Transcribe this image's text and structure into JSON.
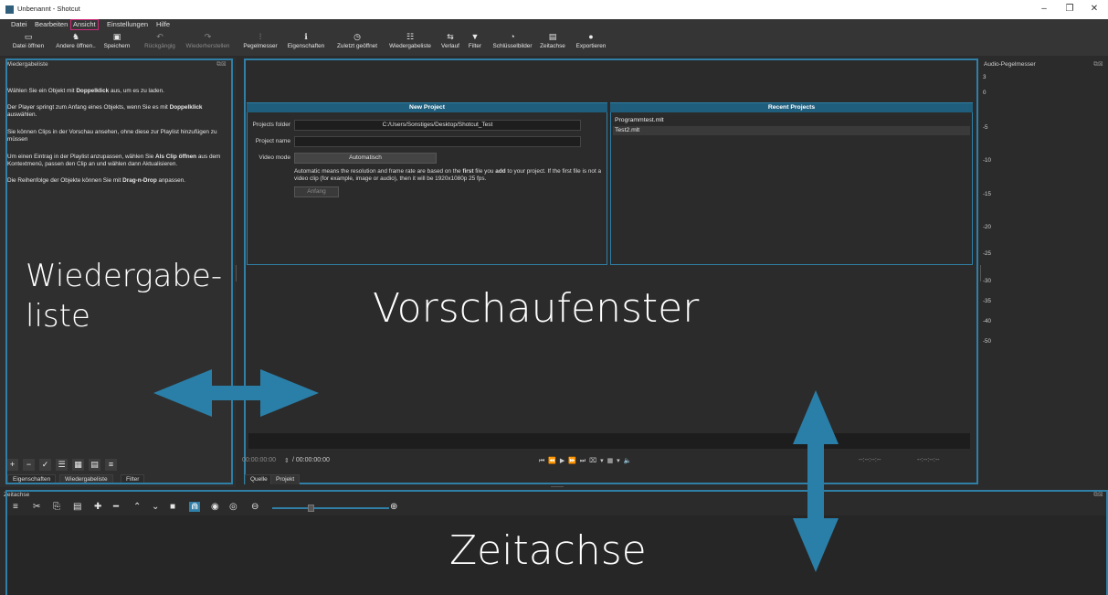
{
  "window": {
    "title": "Unbenannt - Shotcut",
    "controls": [
      "–",
      "❐",
      "✕"
    ]
  },
  "menu": [
    "Datei",
    "Bearbeiten",
    "Ansicht",
    "Einstellungen",
    "Hilfe"
  ],
  "menu_active": "Ansicht",
  "toolbar": [
    {
      "icon": "▭",
      "label": "Datei öffnen"
    },
    {
      "icon": "♞",
      "label": "Andere öffnen.."
    },
    {
      "icon": "▣",
      "label": "Speichern"
    },
    {
      "icon": "↶",
      "label": "Rückgängig"
    },
    {
      "icon": "↷",
      "label": "Wiederherstellen"
    },
    {
      "icon": "⫶",
      "label": "Pegelmesser"
    },
    {
      "icon": "ℹ",
      "label": "Eigenschaften"
    },
    {
      "icon": "◷",
      "label": "Zuletzt geöffnet"
    },
    {
      "icon": "☷",
      "label": "Wiedergabeliste"
    },
    {
      "icon": "⇆",
      "label": "Verlauf"
    },
    {
      "icon": "▼",
      "label": "Filter"
    },
    {
      "icon": "◔",
      "label": "Schlüsselbilder"
    },
    {
      "icon": "▤",
      "label": "Zeitachse"
    },
    {
      "icon": "●",
      "label": "Exportieren"
    }
  ],
  "playlist": {
    "title": "Wiedergabeliste",
    "paragraphs": [
      [
        "Wählen Sie ein Objekt mit ",
        "Doppelklick",
        " aus, um es zu laden."
      ],
      [
        "Der Player springt zum Anfang eines Objekts, wenn Sie es mit ",
        "Doppelklick",
        " auswählen."
      ],
      [
        "Sie können Clips in der Vorschau ansehen, ohne diese zur Playlist hinzufügen zu müssen",
        "",
        ""
      ],
      [
        "Um einen Eintrag in der Playlist anzupassen, wählen Sie ",
        "Als Clip öffnen",
        " aus dem Kontextmenü, passen den Clip an und wählen dann Aktualisieren."
      ],
      [
        "Die Reihenfolge der Objekte können Sie mit ",
        "Drag-n-Drop",
        " anpassen."
      ]
    ],
    "buttons": [
      "+",
      "−",
      "✓",
      "☰",
      "▦",
      "▤",
      "≡"
    ],
    "tabs": [
      "Eigenschaften",
      "Wiedergabeliste",
      "Filter"
    ],
    "overlay": [
      "Wiedergabe-",
      "liste"
    ]
  },
  "preview": {
    "new_project": {
      "header": "New Project",
      "folder_label": "Projects folder",
      "folder_value": "C:/Users/Sonstiges/Desktop/Shotcut_Test",
      "name_label": "Project name",
      "name_value": "",
      "mode_label": "Video mode",
      "mode_value": "Automatisch",
      "note_pre": "Automatic means the resolution and frame rate are based on the ",
      "note_b1": "first",
      "note_mid": " file you ",
      "note_b2": "add",
      "note_post": " to your project. If the first file is not a video clip (for example, image or audio), then it will be 1920x1080p 25 fps.",
      "start_button": "Anfang"
    },
    "recent": {
      "header": "Recent Projects",
      "items": [
        "Programmtest.mlt",
        "Test2.mlt"
      ]
    },
    "overlay": "Vorschaufenster",
    "timecode_current": "00:00:00:00",
    "timecode_total": "/ 00:00:00:00",
    "transport_icons": "⏮  ⏪  ▶  ⏩  ⏭  ⌧ ▾  ▦ ▾  🔈",
    "timecode_in": "--:--:--:--",
    "timecode_out": "--:--:--:--",
    "tabs": [
      "Quelle",
      "Projekt"
    ]
  },
  "audio_meter": {
    "title": "Audio-Pegelmesser",
    "ticks": [
      "3",
      "0",
      "-5",
      "-10",
      "-15",
      "-20",
      "-25",
      "-30",
      "-35",
      "-40",
      "-50"
    ]
  },
  "timeline": {
    "title": "Zeitachse",
    "tools": [
      "≡",
      "✂",
      "⎘",
      "▤",
      "✚",
      "━",
      "⌃",
      "⌄",
      "■",
      "⋒",
      "◉",
      "◎",
      "⊖"
    ],
    "zoom_in": "⊕",
    "overlay": "Zeitachse"
  },
  "colors": {
    "accent": "#2f7fa6",
    "menu_highlight": "#cc2b7a",
    "header_blue": "#1f5e7c"
  }
}
